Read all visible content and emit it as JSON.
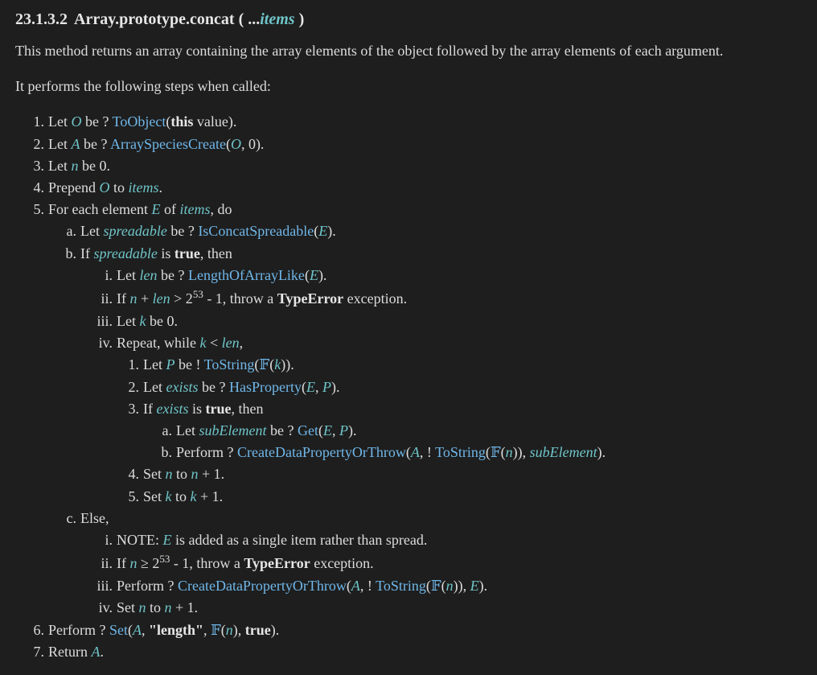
{
  "header": {
    "section_number": "23.1.3.2",
    "title_main": "Array.prototype.concat ( ...",
    "title_param": "items",
    "title_close": " )"
  },
  "intro": {
    "description": "This method returns an array containing the array elements of the object followed by the array elements of each argument.",
    "preamble": "It performs the following steps when called:"
  },
  "steps": {
    "s1": {
      "marker": "1.",
      "t1": "Let ",
      "var1": "O",
      "t2": " be ? ",
      "op": "ToObject",
      "t3": "(",
      "kw": "this",
      "t4": " value)."
    },
    "s2": {
      "marker": "2.",
      "t1": "Let ",
      "var1": "A",
      "t2": " be ? ",
      "op": "ArraySpeciesCreate",
      "t3": "(",
      "var2": "O",
      "t4": ", 0)."
    },
    "s3": {
      "marker": "3.",
      "t1": "Let ",
      "var1": "n",
      "t2": " be 0."
    },
    "s4": {
      "marker": "4.",
      "t1": "Prepend ",
      "var1": "O",
      "t2": " to ",
      "var2": "items",
      "t3": "."
    },
    "s5": {
      "marker": "5.",
      "t1": "For each element ",
      "var1": "E",
      "t2": " of ",
      "var2": "items",
      "t3": ", do"
    },
    "s5a": {
      "marker": "a.",
      "t1": "Let ",
      "var1": "spreadable",
      "t2": " be ? ",
      "op": "IsConcatSpreadable",
      "t3": "(",
      "var2": "E",
      "t4": ")."
    },
    "s5b": {
      "marker": "b.",
      "t1": "If ",
      "var1": "spreadable",
      "t2": " is ",
      "kw": "true",
      "t3": ", then"
    },
    "s5bi": {
      "marker": "i.",
      "t1": "Let ",
      "var1": "len",
      "t2": " be ? ",
      "op": "LengthOfArrayLike",
      "t3": "(",
      "var2": "E",
      "t4": ")."
    },
    "s5bii": {
      "marker": "ii.",
      "t1": "If ",
      "var1": "n",
      "t2": " + ",
      "var2": "len",
      "t3": " > 2",
      "sup": "53",
      "t4": " - 1, throw a ",
      "kw": "TypeError",
      "t5": " exception."
    },
    "s5biii": {
      "marker": "iii.",
      "t1": "Let ",
      "var1": "k",
      "t2": " be 0."
    },
    "s5biv": {
      "marker": "iv.",
      "t1": "Repeat, while ",
      "var1": "k",
      "t2": " < ",
      "var2": "len",
      "t3": ","
    },
    "s5biv1": {
      "marker": "1.",
      "t1": "Let ",
      "var1": "P",
      "t2": " be ! ",
      "op": "ToString",
      "t3": "(",
      "f": "𝔽",
      "t4": "(",
      "var2": "k",
      "t5": "))."
    },
    "s5biv2": {
      "marker": "2.",
      "t1": "Let ",
      "var1": "exists",
      "t2": " be ? ",
      "op": "HasProperty",
      "t3": "(",
      "var2": "E",
      "t4": ", ",
      "var3": "P",
      "t5": ")."
    },
    "s5biv3": {
      "marker": "3.",
      "t1": "If ",
      "var1": "exists",
      "t2": " is ",
      "kw": "true",
      "t3": ", then"
    },
    "s5biv3a": {
      "marker": "a.",
      "t1": "Let ",
      "var1": "subElement",
      "t2": " be ? ",
      "op": "Get",
      "t3": "(",
      "var2": "E",
      "t4": ", ",
      "var3": "P",
      "t5": ")."
    },
    "s5biv3b": {
      "marker": "b.",
      "t1": "Perform ? ",
      "op": "CreateDataPropertyOrThrow",
      "t2": "(",
      "var1": "A",
      "t3": ", ! ",
      "op2": "ToString",
      "t4": "(",
      "f": "𝔽",
      "t5": "(",
      "var2": "n",
      "t6": ")), ",
      "var3": "subElement",
      "t7": ")."
    },
    "s5biv4": {
      "marker": "4.",
      "t1": "Set ",
      "var1": "n",
      "t2": " to ",
      "var2": "n",
      "t3": " + 1."
    },
    "s5biv5": {
      "marker": "5.",
      "t1": "Set ",
      "var1": "k",
      "t2": " to ",
      "var2": "k",
      "t3": " + 1."
    },
    "s5c": {
      "marker": "c.",
      "t1": "Else,"
    },
    "s5ci": {
      "marker": "i.",
      "t1": "NOTE: ",
      "var1": "E",
      "t2": " is added as a single item rather than spread."
    },
    "s5cii": {
      "marker": "ii.",
      "t1": "If ",
      "var1": "n",
      "t2": " ≥ 2",
      "sup": "53",
      "t3": " - 1, throw a ",
      "kw": "TypeError",
      "t4": " exception."
    },
    "s5ciii": {
      "marker": "iii.",
      "t1": "Perform ? ",
      "op": "CreateDataPropertyOrThrow",
      "t2": "(",
      "var1": "A",
      "t3": ", ! ",
      "op2": "ToString",
      "t4": "(",
      "f": "𝔽",
      "t5": "(",
      "var2": "n",
      "t6": ")), ",
      "var3": "E",
      "t7": ")."
    },
    "s5civ": {
      "marker": "iv.",
      "t1": "Set ",
      "var1": "n",
      "t2": " to ",
      "var2": "n",
      "t3": " + 1."
    },
    "s6": {
      "marker": "6.",
      "t1": "Perform ? ",
      "op": "Set",
      "t2": "(",
      "var1": "A",
      "t3": ", ",
      "kw": "\"length\"",
      "t4": ", ",
      "f": "𝔽",
      "t5": "(",
      "var2": "n",
      "t6": "), ",
      "kw2": "true",
      "t7": ")."
    },
    "s7": {
      "marker": "7.",
      "t1": "Return ",
      "var1": "A",
      "t2": "."
    }
  },
  "colors": {
    "background": "#1e1e1e",
    "text": "#dcdcdc",
    "variable": "#6fc5c9",
    "operation_link": "#6fb7e9"
  }
}
